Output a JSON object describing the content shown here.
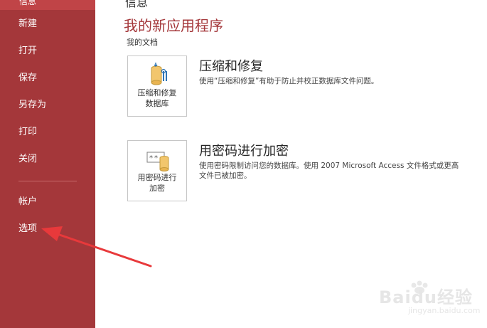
{
  "sidebar": {
    "top_item": "信息",
    "items": [
      {
        "label": "新建"
      },
      {
        "label": "打开"
      },
      {
        "label": "保存"
      },
      {
        "label": "另存为"
      },
      {
        "label": "打印"
      },
      {
        "label": "关闭"
      }
    ],
    "bottom_items": [
      {
        "label": "帐户"
      },
      {
        "label": "选项"
      }
    ]
  },
  "main": {
    "cut_text": "信息",
    "title": "我的新应用程序",
    "subtitle": "我的文档",
    "compact": {
      "tile_label_line1": "压缩和修复",
      "tile_label_line2": "数据库",
      "heading": "压缩和修复",
      "description": "使用“压缩和修复”有助于防止并校正数据库文件问题。"
    },
    "encrypt": {
      "tile_label_line1": "用密码进行",
      "tile_label_line2": "加密",
      "heading": "用密码进行加密",
      "description_line1": "使用密码限制访问您的数据库。使用 2007 Microsoft Access 文件格式或更高",
      "description_line2": "文件已被加密。"
    }
  },
  "watermark": {
    "text": "Baidu经验",
    "url": "jingyan.baidu.com"
  },
  "colors": {
    "sidebar": "#a4373a",
    "accent": "#a4373a",
    "annotation_arrow": "#e8393b"
  }
}
